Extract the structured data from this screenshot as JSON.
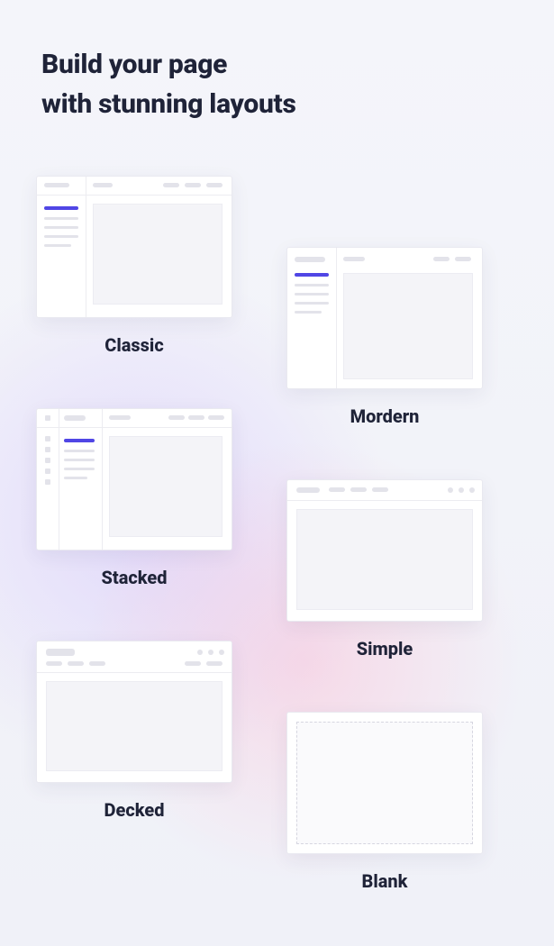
{
  "heading": {
    "line1": "Build your page",
    "line2": "with stunning layouts"
  },
  "layouts": {
    "classic": {
      "label": "Classic"
    },
    "modern": {
      "label": "Mordern"
    },
    "stacked": {
      "label": "Stacked"
    },
    "simple": {
      "label": "Simple"
    },
    "decked": {
      "label": "Decked"
    },
    "blank": {
      "label": "Blank"
    }
  }
}
